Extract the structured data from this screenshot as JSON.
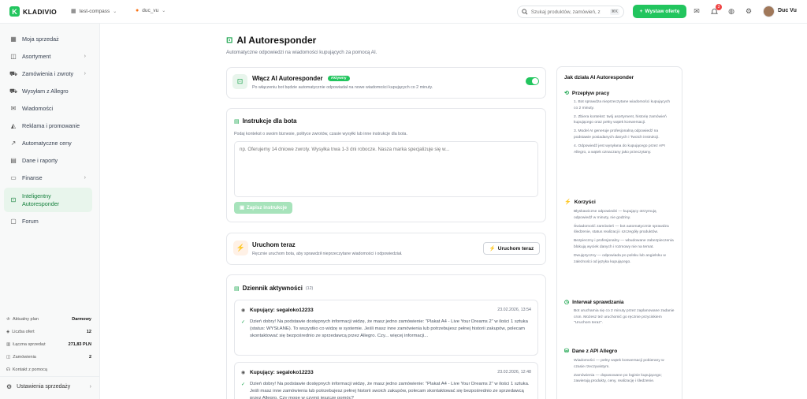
{
  "brand": {
    "name": "KLADIVIO",
    "color": "#22c55e"
  },
  "header": {
    "workspace": "test-compass",
    "account": "duc_vu",
    "search_placeholder": "Szukaj produktów, zamówień, z",
    "search_kbd": "⌘K",
    "add_offer": "Wystaw ofertę",
    "notification_count": "3",
    "user_name": "Duc Vu"
  },
  "sidebar": {
    "items": [
      {
        "label": "Moja sprzedaż",
        "icon": "grid-icon"
      },
      {
        "label": "Asortyment",
        "icon": "box-icon"
      },
      {
        "label": "Zamówienia i zwroty",
        "icon": "cart-icon"
      },
      {
        "label": "Wysyłam z Allegro",
        "icon": "truck-icon"
      },
      {
        "label": "Wiadomości",
        "icon": "mail-icon"
      },
      {
        "label": "Reklama i promowanie",
        "icon": "megaphone-icon"
      },
      {
        "label": "Automatyczne ceny",
        "icon": "trend-icon"
      },
      {
        "label": "Dane i raporty",
        "icon": "file-icon"
      },
      {
        "label": "Finanse",
        "icon": "wallet-icon"
      },
      {
        "label_line1": "Inteligentny",
        "label_line2": "Autoresponder",
        "icon": "robot-icon"
      },
      {
        "label": "Forum",
        "icon": "chat-icon"
      }
    ],
    "stats": [
      {
        "label": "Aktualny plan",
        "value": "Darmowy"
      },
      {
        "label": "Liczba ofert",
        "value": "12"
      },
      {
        "label": "Łączna sprzedaż",
        "value": "271,83 PLN"
      },
      {
        "label": "Zamówienia",
        "value": "2"
      },
      {
        "label": "Kontakt z pomocą",
        "value": ""
      }
    ],
    "settings": "Ustawienia sprzedaży"
  },
  "main": {
    "title": "AI Autoresponder",
    "subtitle": "Automatyczne odpowiedzi na wiadomości kupujących za pomocą AI.",
    "enable_card": {
      "title": "Włącz AI Autoresponder",
      "badge": "Aktywny",
      "description": "Po włączeniu bot będzie automatycznie odpowiadał na nowe wiadomości kupujących co 2 minuty.",
      "enabled": true
    },
    "instructions_card": {
      "title": "Instrukcje dla bota",
      "description": "Podaj kontekst o swoim biznesie, polityce zwrotów, czasie wysyłki lub inne instrukcje dla bota.",
      "placeholder": "np. Oferujemy 14 dniowe zwroty. Wysyłka trwa 1-3 dni robocze. Nasza marka specjalizuje się w...",
      "save_label": "Zapisz instrukcje"
    },
    "run_card": {
      "title": "Uruchom teraz",
      "description": "Ręcznie uruchom bota, aby sprawdził nieprzeczytane wiadomości i odpowiedział.",
      "button": "Uruchom teraz"
    },
    "log_card": {
      "title": "Dziennik aktywności",
      "count": "(12)",
      "entries": [
        {
          "buyer": "Kupujący: segaloko12233",
          "date": "23.02.2026, 13:54",
          "text": "Dzień dobry! Na podstawie dostępnych informacji widzę, że masz jedno zamówienie: \"Plakat A4 - Live Your Dreams 2\" w ilości 1 sztuka (status: WYSŁANE). To wszystko co widzę w systemie. Jeśli masz inne zamówienia lub potrzebujesz pełnej historii zakupów, polecam skontaktować się bezpośrednio ze sprzedawcą przez Allegro. Czy... ",
          "more": "więcej informacji..."
        },
        {
          "buyer": "Kupujący: segaloko12233",
          "date": "23.02.2026, 12:48",
          "text": "Dzień dobry! Na podstawie dostępnych informacji widzę, że masz jedno zamówienie: \"Plakat A4 - Live Your Dreams 2\" w ilości 1 sztuka. Jeśli masz inne zamówienia lub potrzebujesz pełnej historii swoich zakupów, polecam skontaktować się bezpośrednio ze sprzedawcą przez Allegro. Czy mogę w czymś jeszcze pomóc?",
          "more": ""
        }
      ]
    }
  },
  "info_panel": {
    "title": "Jak działa AI Autoresponder",
    "workflow_title": "Przepływ pracy",
    "workflow": [
      "1. Bot sprawdza nieprzeczytane wiadomości kupujących co 2 minuty.",
      "2. Zbiera kontekst: twój asortyment, historię zamówień kupującego oraz pełny wątek konwersacji.",
      "3. Model AI generuje profesjonalną odpowiedź na podstawie posiadanych danych i Twoich instrukcji.",
      "4. Odpowiedź jest wysyłana do kupującego przez API Allegro, a wątek oznaczany jako przeczytany."
    ],
    "benefits_title": "Korzyści",
    "benefits": [
      "Błyskawiczne odpowiedzi — kupujący otrzymują odpowiedź w minuty, nie godziny.",
      "Świadomość zamówień — bot automatycznie sprawdza śledzenie, status realizacji i szczegóły produktów.",
      "Bezpieczny i profesjonalny — wbudowane zabezpieczenia blokują wyciek danych i rozmowy nie na temat.",
      "Dwujęzyczny — odpowiada po polsku lub angielsku w zależności od języka kupującego."
    ],
    "interval_title": "Interwał sprawdzania",
    "interval_text": "Bot uruchamia się co 2 minuty przez zaplanowane zadanie cron. Możesz też uruchomić go ręcznie przyciskiem \"Uruchom teraz\".",
    "api_title": "Dane z API Allegro",
    "api": [
      "Wiadomości — pełny wątek konwersacji pobierany w czasie rzeczywistym.",
      "Zamówienia — dopasowane po loginie kupującego; zawierają produkty, ceny, realizację i śledzenie."
    ]
  }
}
